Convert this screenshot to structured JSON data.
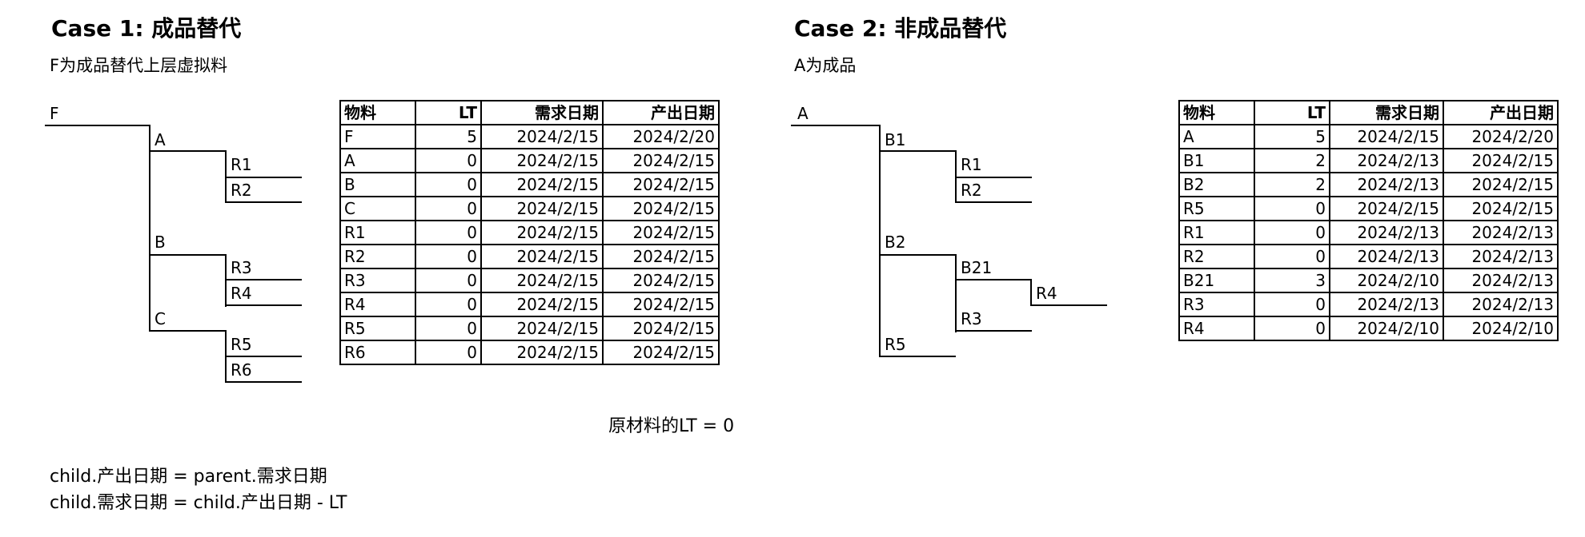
{
  "case1": {
    "title": "Case 1: 成品替代",
    "subtitle": "F为成品替代上层虚拟料",
    "tree": {
      "root": "F",
      "level1": [
        "A",
        "B",
        "C"
      ],
      "leaves": [
        "R1",
        "R2",
        "R3",
        "R4",
        "R5",
        "R6"
      ]
    },
    "table": {
      "headers": [
        "物料",
        "LT",
        "需求日期",
        "产出日期"
      ],
      "rows": [
        [
          "F",
          "5",
          "2024/2/15",
          "2024/2/20"
        ],
        [
          "A",
          "0",
          "2024/2/15",
          "2024/2/15"
        ],
        [
          "B",
          "0",
          "2024/2/15",
          "2024/2/15"
        ],
        [
          "C",
          "0",
          "2024/2/15",
          "2024/2/15"
        ],
        [
          "R1",
          "0",
          "2024/2/15",
          "2024/2/15"
        ],
        [
          "R2",
          "0",
          "2024/2/15",
          "2024/2/15"
        ],
        [
          "R3",
          "0",
          "2024/2/15",
          "2024/2/15"
        ],
        [
          "R4",
          "0",
          "2024/2/15",
          "2024/2/15"
        ],
        [
          "R5",
          "0",
          "2024/2/15",
          "2024/2/15"
        ],
        [
          "R6",
          "0",
          "2024/2/15",
          "2024/2/15"
        ]
      ]
    }
  },
  "case2": {
    "title": "Case 2: 非成品替代",
    "subtitle": "A为成品",
    "tree": {
      "root": "A",
      "level1": [
        "B1",
        "B2",
        "R5"
      ],
      "level2": [
        "R1",
        "R2",
        "B21",
        "R3"
      ],
      "level3": [
        "R4"
      ]
    },
    "table": {
      "headers": [
        "物料",
        "LT",
        "需求日期",
        "产出日期"
      ],
      "rows": [
        [
          "A",
          "5",
          "2024/2/15",
          "2024/2/20"
        ],
        [
          "B1",
          "2",
          "2024/2/13",
          "2024/2/15"
        ],
        [
          "B2",
          "2",
          "2024/2/13",
          "2024/2/15"
        ],
        [
          "R5",
          "0",
          "2024/2/15",
          "2024/2/15"
        ],
        [
          "R1",
          "0",
          "2024/2/13",
          "2024/2/13"
        ],
        [
          "R2",
          "0",
          "2024/2/13",
          "2024/2/13"
        ],
        [
          "B21",
          "3",
          "2024/2/10",
          "2024/2/13"
        ],
        [
          "R3",
          "0",
          "2024/2/13",
          "2024/2/13"
        ],
        [
          "R4",
          "0",
          "2024/2/10",
          "2024/2/10"
        ]
      ]
    }
  },
  "notes": {
    "raw_material_lt": "原材料的LT = 0",
    "formula1": "child.产出日期 = parent.需求日期",
    "formula2": "child.需求日期 = child.产出日期 - LT"
  }
}
